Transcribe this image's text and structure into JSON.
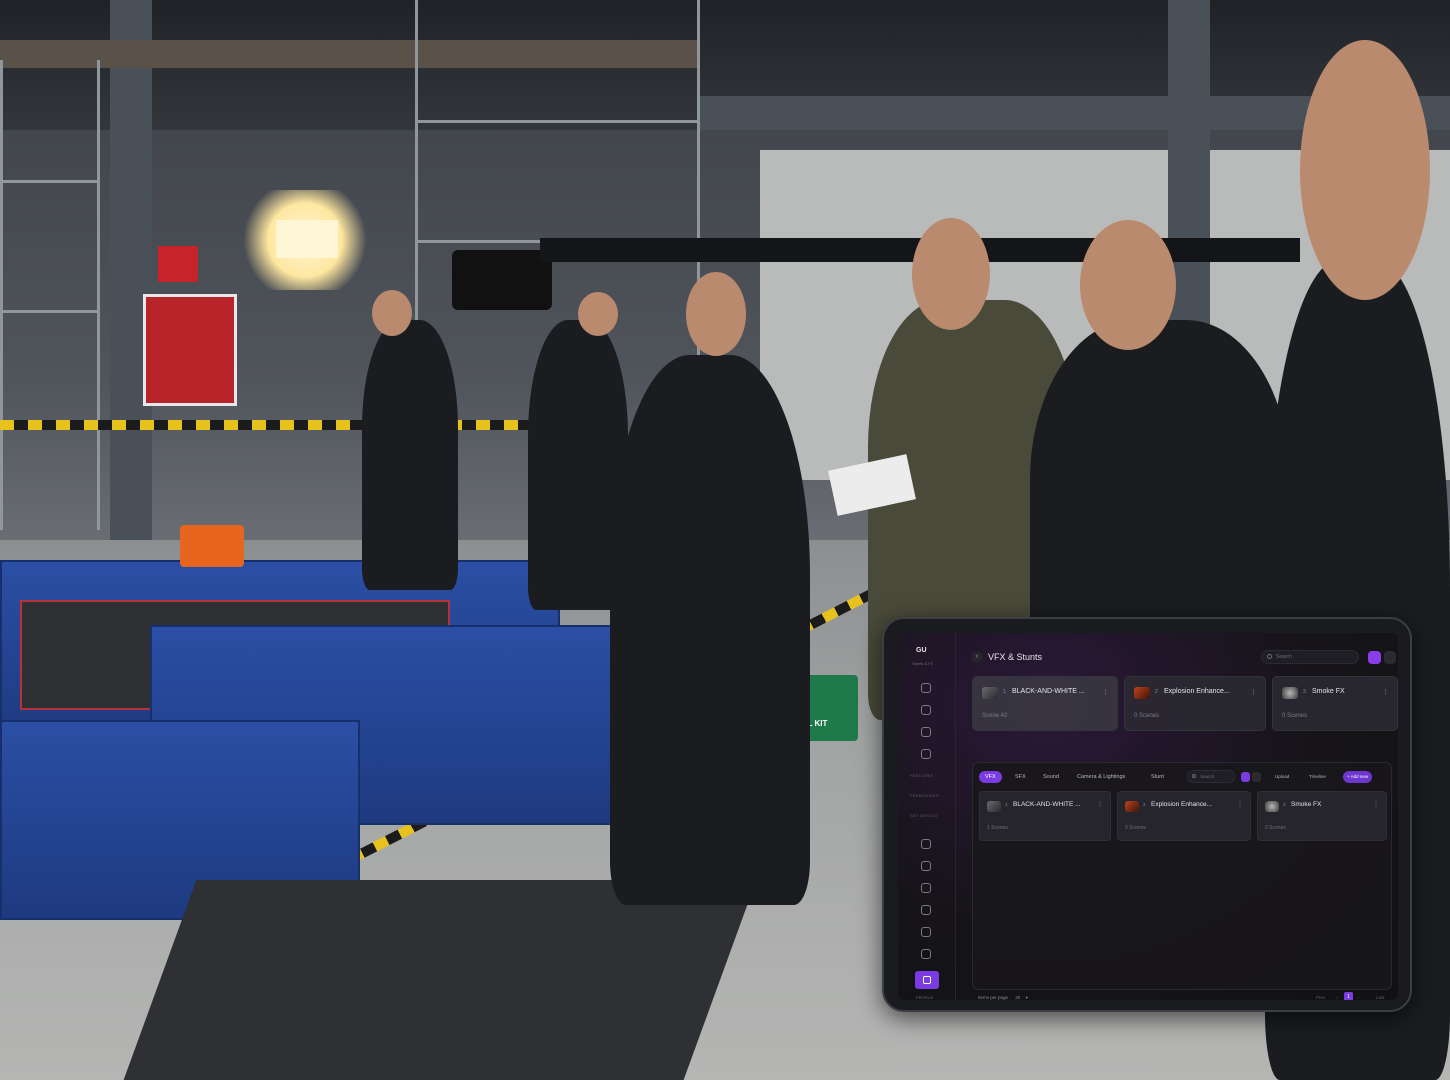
{
  "scene": {
    "caption": "",
    "medical_kit_label": "MEDICAL KIT"
  },
  "tablet": {
    "app": {
      "logo": "GU",
      "brand_sub": "Stunts & FX"
    },
    "sidebar": {
      "group_labels": [
        "FEATURES",
        "FRANCHISES",
        "SET DESIGN"
      ],
      "bottom_label": "PROFILE"
    },
    "header": {
      "back_icon": "chevron-left-icon",
      "title": "VFX & Stunts",
      "search_placeholder": "Search"
    },
    "top_cards": [
      {
        "index": "1",
        "name": "BLACK-AND-WHITE ...",
        "count": "Scene 42"
      },
      {
        "index": "2",
        "name": "Explosion Enhance...",
        "count": "0 Scenes"
      },
      {
        "index": "3",
        "name": "Smoke FX",
        "count": "0 Scenes"
      }
    ],
    "panel": {
      "tabs": [
        "VFX",
        "SFX",
        "Sound",
        "Camera & Lightings",
        "Stunt"
      ],
      "active_tab": "VFX",
      "search_placeholder": "Search",
      "chips": [
        "Upload",
        "Timeline",
        "+ Add new"
      ],
      "items": [
        {
          "index": "1",
          "name": "BLACK-AND-WHITE ...",
          "count": "1 Scenes"
        },
        {
          "index": "2",
          "name": "Explosion Enhance...",
          "count": "0 Scenes"
        },
        {
          "index": "3",
          "name": "Smoke FX",
          "count": "0 Scenes"
        }
      ]
    },
    "pagination": {
      "items_per_page_label": "Items per page",
      "items_per_page_value": "20",
      "prev": "Prev",
      "current_page": "1",
      "next": "Next",
      "last": "Last"
    },
    "colors": {
      "accent": "#7a3be0",
      "background": "#161418"
    }
  }
}
